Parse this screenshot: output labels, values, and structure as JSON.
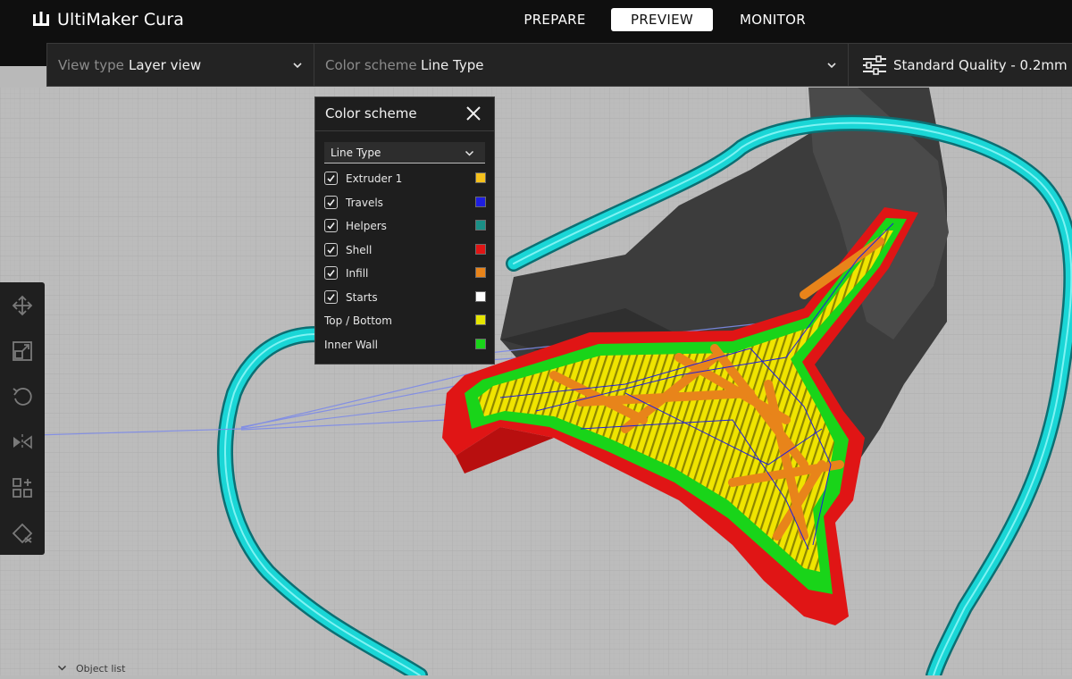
{
  "app": {
    "title": "UltiMaker Cura"
  },
  "stages": [
    {
      "label": "PREPARE",
      "active": false
    },
    {
      "label": "PREVIEW",
      "active": true
    },
    {
      "label": "MONITOR",
      "active": false
    }
  ],
  "toolbar": {
    "view_type": {
      "label": "View type",
      "value": "Layer view"
    },
    "color_scheme": {
      "label": "Color scheme",
      "value": "Line Type"
    },
    "quality": {
      "label": "Standard Quality - 0.2mm",
      "icon": "sliders-icon"
    }
  },
  "tools": [
    {
      "name": "move-tool",
      "icon": "move-icon"
    },
    {
      "name": "scale-tool",
      "icon": "scale-icon"
    },
    {
      "name": "rotate-tool",
      "icon": "rotate-icon"
    },
    {
      "name": "mirror-tool",
      "icon": "mirror-icon"
    },
    {
      "name": "per-model-settings-tool",
      "icon": "per-model-settings-icon"
    },
    {
      "name": "support-blocker-tool",
      "icon": "support-blocker-icon"
    }
  ],
  "color_scheme_panel": {
    "title": "Color scheme",
    "selected": "Line Type",
    "items": [
      {
        "label": "Extruder 1",
        "checked": true,
        "color": "#f5c11c"
      },
      {
        "label": "Travels",
        "checked": true,
        "color": "#1e1ee0"
      },
      {
        "label": "Helpers",
        "checked": true,
        "color": "#1a8f86"
      },
      {
        "label": "Shell",
        "checked": true,
        "color": "#e01515"
      },
      {
        "label": "Infill",
        "checked": true,
        "color": "#e8841a"
      },
      {
        "label": "Starts",
        "checked": true,
        "color": "#ffffff"
      },
      {
        "label": "Top / Bottom",
        "checked": null,
        "color": "#e6e600"
      },
      {
        "label": "Inner Wall",
        "checked": null,
        "color": "#19d419"
      }
    ]
  },
  "object_list": {
    "label": "Object list"
  },
  "colors": {
    "accent": "#ffffff",
    "topbar": "#0f0f0f",
    "skirt": "#1ad6d6",
    "shell": "#e01515",
    "inner_wall": "#19d419",
    "top_bottom": "#e6e600",
    "infill": "#e8841a",
    "travels": "#1e1ee0"
  }
}
